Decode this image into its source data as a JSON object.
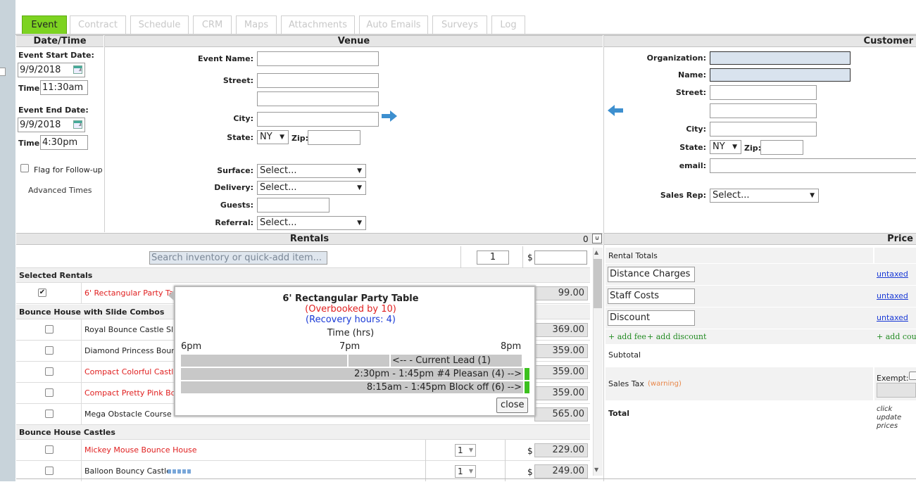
{
  "tabs": [
    {
      "label": "Event",
      "active": true
    },
    {
      "label": "Contract"
    },
    {
      "label": "Schedule"
    },
    {
      "label": "CRM"
    },
    {
      "label": "Maps"
    },
    {
      "label": "Attachments"
    },
    {
      "label": "Auto Emails"
    },
    {
      "label": "Surveys"
    },
    {
      "label": "Log"
    }
  ],
  "datetime": {
    "header": "Date/Time",
    "start_label": "Event Start Date:",
    "start_date": "9/9/2018",
    "start_time_label": "Time:",
    "start_time": "11:30am",
    "end_label": "Event End Date:",
    "end_date": "9/9/2018",
    "end_time_label": "Time:",
    "end_time": "4:30pm",
    "flag_label": "Flag for Follow-up",
    "advanced_label": "Advanced Times"
  },
  "venue": {
    "header": "Venue",
    "event_name_label": "Event Name:",
    "street_label": "Street:",
    "city_label": "City:",
    "state_label": "State:",
    "state_value": "NY",
    "zip_label": "Zip:",
    "surface_label": "Surface:",
    "surface_value": "Select...",
    "delivery_label": "Delivery:",
    "delivery_value": "Select...",
    "guests_label": "Guests:",
    "referral_label": "Referral:",
    "referral_value": "Select..."
  },
  "customer": {
    "header": "Customer",
    "org_label": "Organization:",
    "name_label": "Name:",
    "street_label": "Street:",
    "city_label": "City:",
    "state_label": "State:",
    "state_value": "NY",
    "zip_label": "Zip:",
    "email_label": "email:",
    "sales_rep_label": "Sales Rep:",
    "sales_rep_value": "Select..."
  },
  "rentals": {
    "header": "Rentals",
    "count": "0",
    "search_placeholder": "Search inventory or quick-add item...",
    "qty_default": "1",
    "currency": "$",
    "selected_group": "Selected Rentals",
    "selected_items": [
      {
        "name": "6' Rectangular Party Table",
        "checked": true,
        "price": "99.00",
        "red": true
      }
    ],
    "groups": [
      {
        "title": "Bounce House with Slide Combos",
        "items": [
          {
            "name": "Royal Bounce Castle Slid",
            "price": "369.00",
            "red": false
          },
          {
            "name": "Diamond Princess Bounc",
            "price": "359.00",
            "red": false
          },
          {
            "name": "Compact Colorful Castle S",
            "price": "359.00",
            "red": true
          },
          {
            "name": "Compact Pretty Pink Bou",
            "price": "359.00",
            "red": true
          },
          {
            "name": "Mega Obstacle Course B",
            "price": "565.00",
            "red": false
          }
        ]
      },
      {
        "title": "Bounce House Castles",
        "items": [
          {
            "name": "Mickey Mouse Bounce House",
            "price": "229.00",
            "qty": "1",
            "red": true
          },
          {
            "name": "Balloon Bouncy Castle",
            "price": "249.00",
            "qty": "1",
            "red": false
          }
        ]
      }
    ]
  },
  "popup": {
    "title": "6' Rectangular Party Table",
    "overbooked": "(Overbooked by 10)",
    "recovery": "(Recovery hours: 4)",
    "time_label": "Time (hrs)",
    "ticks": [
      "6pm",
      "7pm",
      "8pm"
    ],
    "current_lead": "<-- -    Current Lead   (1)",
    "booking1": "2:30pm - 1:45pm   #4 Pleasan   (4) -->",
    "booking2": "8:15am - 1:45pm   Block off   (6) -->",
    "close_label": "close"
  },
  "price": {
    "header": "Price",
    "rental_totals": "Rental Totals",
    "lines": [
      {
        "label": "Distance Charges",
        "link": "untaxed"
      },
      {
        "label": "Staff Costs",
        "link": "untaxed"
      },
      {
        "label": "Discount",
        "link": "untaxed"
      }
    ],
    "add_fee": "+ add fee",
    "add_discount": "+ add discount",
    "add_coupon": "+ add coupo",
    "subtotal": "Subtotal",
    "sales_tax": "Sales Tax",
    "warning": "(warning)",
    "exempt": "Exempt:",
    "total": "Total",
    "update_note": "click update prices"
  },
  "colors": {
    "active_tab": "#7dd321",
    "red_item": "#e02020",
    "link": "#1a3ad6",
    "arrow": "#3d8fcf",
    "green_tick": "#3cc11f"
  }
}
